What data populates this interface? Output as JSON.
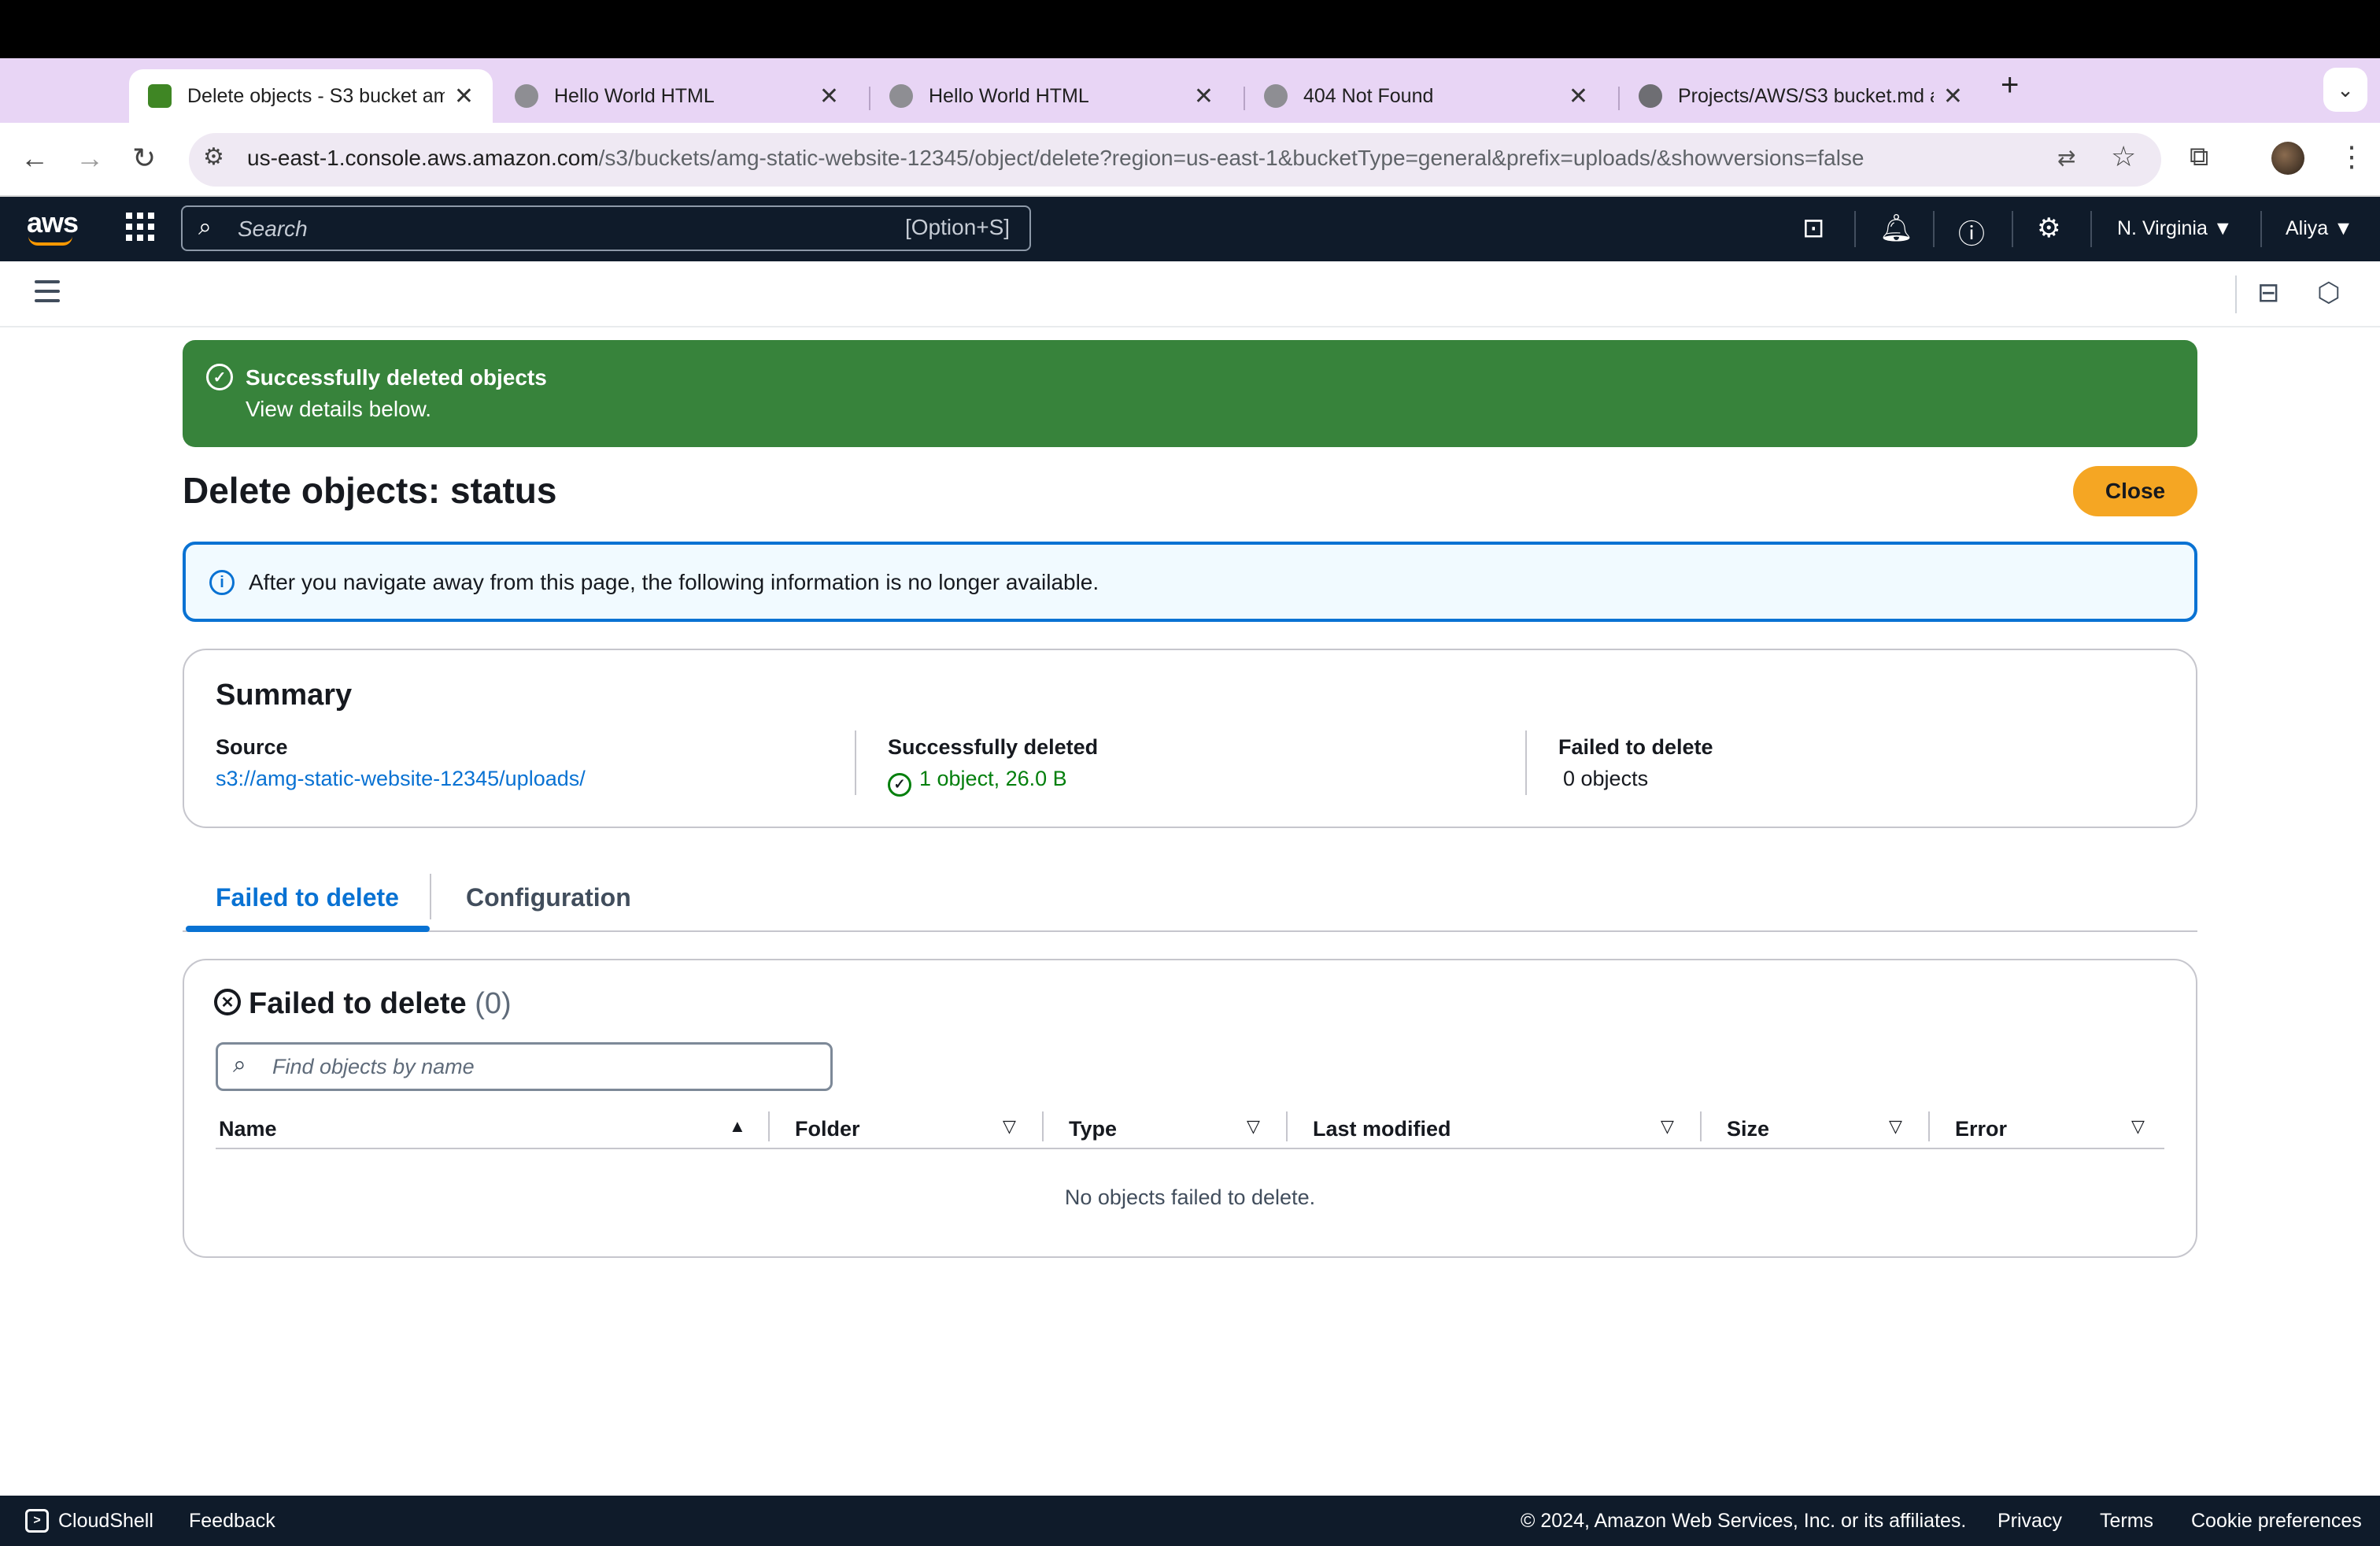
{
  "browser": {
    "tabs": [
      {
        "title": "Delete objects - S3 bucket am",
        "active": true,
        "favicon": "aws-s3-icon"
      },
      {
        "title": "Hello World HTML",
        "active": false,
        "favicon": "globe-icon"
      },
      {
        "title": "Hello World HTML",
        "active": false,
        "favicon": "globe-icon"
      },
      {
        "title": "404 Not Found",
        "active": false,
        "favicon": "globe-icon"
      },
      {
        "title": "Projects/AWS/S3 bucket.md a",
        "active": false,
        "favicon": "github-icon"
      }
    ],
    "new_tab": "+",
    "tab_menu": "⌄",
    "url": {
      "host": "us-east-1.console.aws.amazon.com",
      "path": "/s3/buckets/amg-static-website-12345/object/delete?region=us-east-1&bucketType=general&prefix=uploads/&showversions=false"
    }
  },
  "aws_nav": {
    "logo": "aws",
    "search_placeholder": "Search",
    "search_shortcut": "[Option+S]",
    "region": "N. Virginia",
    "user": "Aliya"
  },
  "flash": {
    "title": "Successfully deleted objects",
    "subtitle": "View details below.",
    "color": "#37833b"
  },
  "page": {
    "title": "Delete objects: status",
    "close_label": "Close"
  },
  "info_alert": {
    "text": "After you navigate away from this page, the following information is no longer available."
  },
  "summary": {
    "title": "Summary",
    "source_label": "Source",
    "source_value": "s3://amg-static-website-12345/uploads/",
    "deleted_label": "Successfully deleted",
    "deleted_value": "1 object, 26.0 B",
    "failed_label": "Failed to delete",
    "failed_value": "0 objects"
  },
  "tabs": [
    {
      "label": "Failed to delete",
      "active": true
    },
    {
      "label": "Configuration",
      "active": false
    }
  ],
  "failed_table": {
    "title": "Failed to delete",
    "count": "(0)",
    "filter_placeholder": "Find objects by name",
    "columns": [
      "Name",
      "Folder",
      "Type",
      "Last modified",
      "Size",
      "Error"
    ],
    "empty_message": "No objects failed to delete."
  },
  "footer": {
    "cloudshell": "CloudShell",
    "feedback": "Feedback",
    "copyright": "© 2024, Amazon Web Services, Inc. or its affiliates.",
    "privacy": "Privacy",
    "terms": "Terms",
    "cookie": "Cookie preferences"
  },
  "colors": {
    "accent": "#0972d3",
    "success": "#037f0c",
    "primary_button": "#f5a623",
    "nav_bg": "#0f1b2a"
  }
}
